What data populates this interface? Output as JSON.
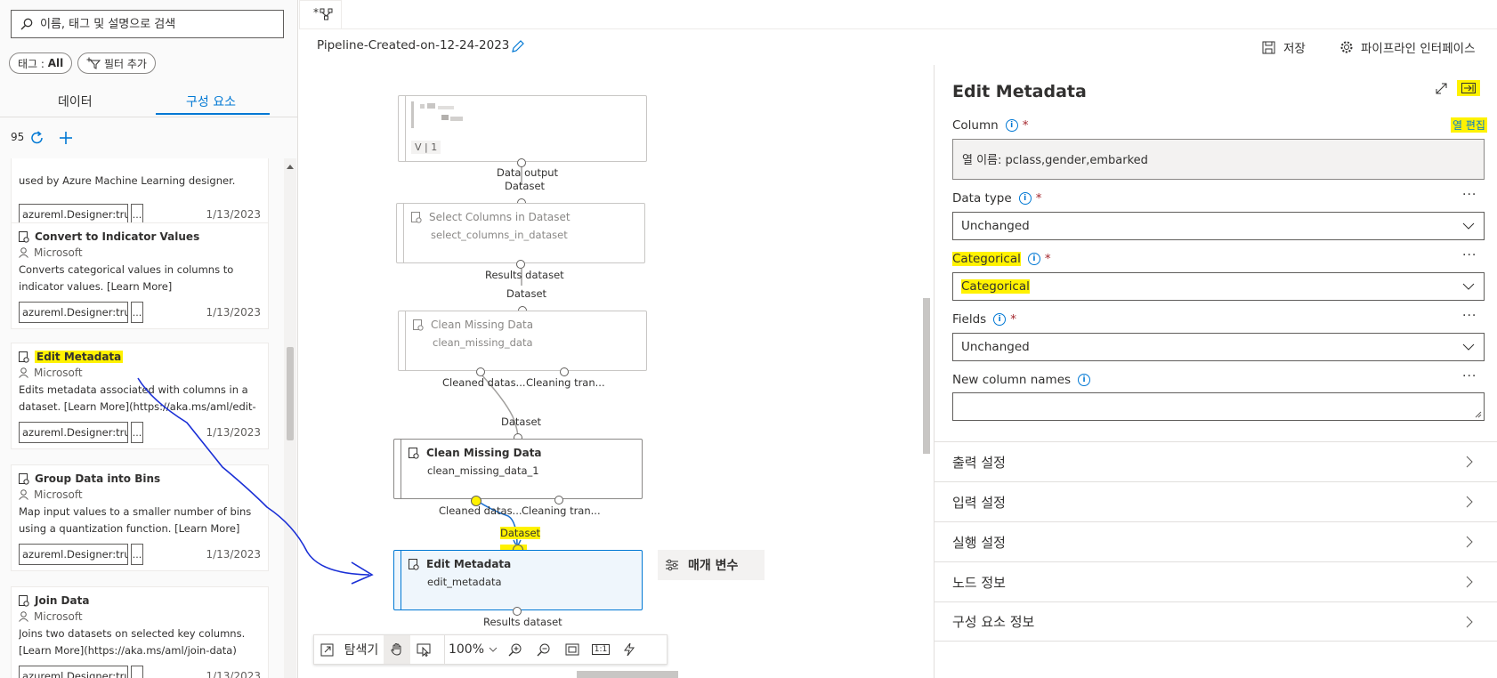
{
  "left_panel": {
    "search_placeholder": "이름, 태그 및 설명으로 검색",
    "tag_filter_prefix": "태그 : ",
    "tag_filter_value": "All",
    "add_filter_label": "필터 추가",
    "tabs": [
      {
        "label": "데이터",
        "active": false
      },
      {
        "label": "구성 요소",
        "active": true
      }
    ],
    "count": "95",
    "cards": [
      {
        "title": "",
        "author": "",
        "desc": "used by Azure Machine Learning designer. [Learn ...",
        "tag": "azureml.Designer:true",
        "more": "...",
        "date": "1/13/2023"
      },
      {
        "title": "Convert to Indicator Values",
        "author": "Microsoft",
        "desc": "Converts categorical values in columns to indicator values. [Learn More](https://aka.ms/aml/convert-t...",
        "tag": "azureml.Designer:true",
        "more": "...",
        "date": "1/13/2023"
      },
      {
        "title": "Edit Metadata",
        "author": "Microsoft",
        "desc": "Edits metadata associated with columns in a dataset. [Learn More](https://aka.ms/aml/edit-me...",
        "tag": "azureml.Designer:true",
        "more": "...",
        "date": "1/13/2023",
        "highlight": true
      },
      {
        "title": "Group Data into Bins",
        "author": "Microsoft",
        "desc": "Map input values to a smaller number of bins using a quantization function. [Learn More](https://aka....",
        "tag": "azureml.Designer:true",
        "more": "...",
        "date": "1/13/2023"
      },
      {
        "title": "Join Data",
        "author": "Microsoft",
        "desc": "Joins two datasets on selected key columns. [Learn More](https://aka.ms/aml/join-data)",
        "tag": "azureml.Designer:true",
        "more": "...",
        "date": "1/13/2023"
      }
    ]
  },
  "header": {
    "tab_label": "*",
    "pipeline_title": "Pipeline-Created-on-12-24-2023",
    "save_label": "저장",
    "pipeline_interface_label": "파이프라인 인터페이스"
  },
  "canvas": {
    "nodes": [
      {
        "title": "",
        "sub": "",
        "version": "V | 1"
      },
      {
        "title": "Select Columns in Dataset",
        "sub": "select_columns_in_dataset"
      },
      {
        "title": "Clean Missing Data",
        "sub": "clean_missing_data"
      },
      {
        "title": "Clean Missing Data",
        "sub": "clean_missing_data_1"
      },
      {
        "title": "Edit Metadata",
        "sub": "edit_metadata"
      }
    ],
    "port_labels": {
      "data_output": "Data output",
      "dataset": "Dataset",
      "results_dataset": "Results dataset",
      "cleaned": "Cleaned datas...",
      "cleaning": "Cleaning tran..."
    },
    "param_button": "매개 변수",
    "toolbar": {
      "explorer": "탐색기",
      "zoom": "100%",
      "one_to_one": "1:1"
    }
  },
  "right_panel": {
    "title": "Edit Metadata",
    "column_label": "Column",
    "edit_columns": "열 편집",
    "column_value": "열 이름: pclass,gender,embarked",
    "data_type_label": "Data type",
    "data_type_value": "Unchanged",
    "categorical_label": "Categorical",
    "categorical_value": "Categorical",
    "fields_label": "Fields",
    "fields_value": "Unchanged",
    "new_column_names_label": "New column names",
    "more": "···",
    "required": "*",
    "sections": [
      "출력 설정",
      "입력 설정",
      "실행 설정",
      "노드 정보",
      "구성 요소 정보"
    ]
  },
  "colors": {
    "accent": "#0078d4",
    "highlight": "#fff200",
    "annotation_stroke": "#1a2fd6"
  }
}
